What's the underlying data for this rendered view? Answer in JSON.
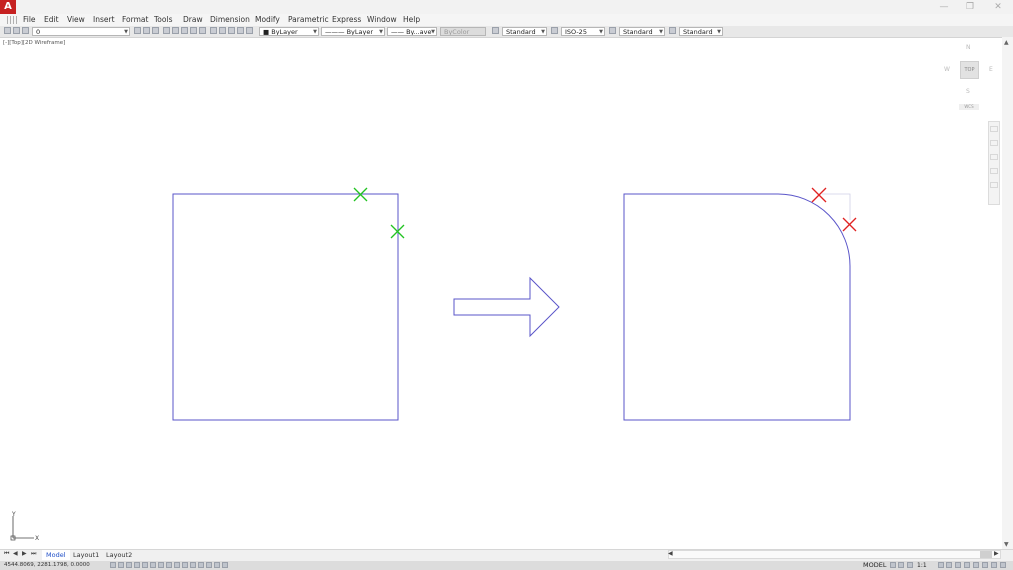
{
  "app": {
    "logo_letter": "A",
    "window_buttons": {
      "minimize": "—",
      "restore": "❐",
      "close": "✕"
    }
  },
  "menu": [
    "File",
    "Edit",
    "View",
    "Insert",
    "Format",
    "Tools",
    "Draw",
    "Dimension",
    "Modify",
    "Parametric",
    "Express",
    "Window",
    "Help"
  ],
  "toolbar": {
    "layer_value": "0",
    "color_value": "ByLayer",
    "linetype_value": "ByLayer",
    "lineweight_value": "By...ave",
    "plotstyle_value": "ByColor",
    "text_style": "Standard",
    "dim_style": "ISO-25",
    "table_style": "Standard",
    "mleader_style": "Standard"
  },
  "viewport": {
    "label": "[-][Top][2D Wireframe]"
  },
  "viewcube": {
    "north": "N",
    "west": "W",
    "east": "E",
    "south": "S",
    "top": "TOP",
    "wcs": "WCS"
  },
  "ucs": {
    "x_label": "X",
    "y_label": "Y"
  },
  "tabs": {
    "items": [
      "Model",
      "Layout1",
      "Layout2"
    ],
    "active": "Model"
  },
  "status": {
    "coordinates": "4544.8069, 2281.1798, 0.0000",
    "space": "MODEL",
    "annotation_scale": "1:1"
  },
  "colors": {
    "geometry": "#5a55c9",
    "marker_green": "#22c322",
    "marker_red": "#e02222",
    "accent": "#c62121"
  },
  "icons": {
    "titlebar": "app-logo-icon",
    "markers_left": "green-x-marker",
    "markers_right": "red-x-marker",
    "arrow": "right-arrow-shape"
  }
}
